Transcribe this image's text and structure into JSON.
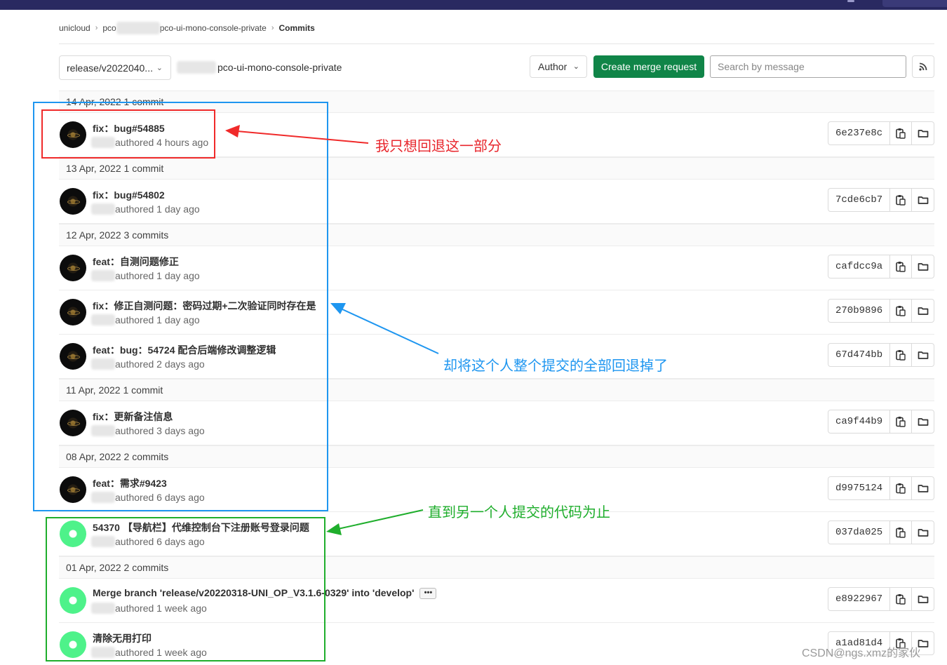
{
  "breadcrumb": {
    "group": "unicloud",
    "project_prefix": "pco",
    "project_suffix": "pco-ui-mono-console-private",
    "current": "Commits"
  },
  "toolbar": {
    "branch": "release/v2022040...",
    "repo_path": "pco-ui-mono-console-private",
    "author_label": "Author",
    "merge_request_label": "Create merge request",
    "search_placeholder": "Search by message",
    "rss_icon": "rss-icon"
  },
  "dates": [
    "14 Apr, 2022 1 commit",
    "13 Apr, 2022 1 commit",
    "12 Apr, 2022 3 commits",
    "11 Apr, 2022 1 commit",
    "08 Apr, 2022 2 commits",
    "01 Apr, 2022 2 commits"
  ],
  "commits": [
    {
      "title": "fix：bug#54885",
      "meta": "authored 4 hours ago",
      "sha": "6e237e8c"
    },
    {
      "title": "fix：bug#54802",
      "meta": "authored 1 day ago",
      "sha": "7cde6cb7"
    },
    {
      "title": "feat：自测问题修正",
      "meta": "authored 1 day ago",
      "sha": "cafdcc9a"
    },
    {
      "title": "fix：修正自测问题：密码过期+二次验证同时存在是",
      "meta": "authored 1 day ago",
      "sha": "270b9896"
    },
    {
      "title": "feat：bug：54724 配合后端修改调整逻辑",
      "meta": "authored 2 days ago",
      "sha": "67d474bb"
    },
    {
      "title": "fix：更新备注信息",
      "meta": "authored 3 days ago",
      "sha": "ca9f44b9"
    },
    {
      "title": "feat：需求#9423",
      "meta": "authored 6 days ago",
      "sha": "d9975124"
    },
    {
      "title": "54370 【导航栏】代维控制台下注册账号登录问题",
      "meta": "authored 6 days ago",
      "sha": "037da025"
    },
    {
      "title": "Merge branch 'release/v20220318-UNI_OP_V3.1.6-0329' into 'develop'",
      "meta": "authored 1 week ago",
      "sha": "e8922967",
      "ellipsis": "•••"
    },
    {
      "title": "清除无用打印",
      "meta": "authored 1 week ago",
      "sha": "a1ad81d4"
    }
  ],
  "annotations": {
    "red": "我只想回退这一部分",
    "blue": "却将这个人整个提交的全部回退掉了",
    "green": "直到另一个人提交的代码为止",
    "colors": {
      "red": "#f02a2a",
      "blue": "#1e96f0",
      "green": "#1fae2c"
    }
  },
  "watermark": "CSDN@ngs.xmz的家伙",
  "theme": {
    "topbar": "#292961",
    "primary_button": "#108548"
  }
}
